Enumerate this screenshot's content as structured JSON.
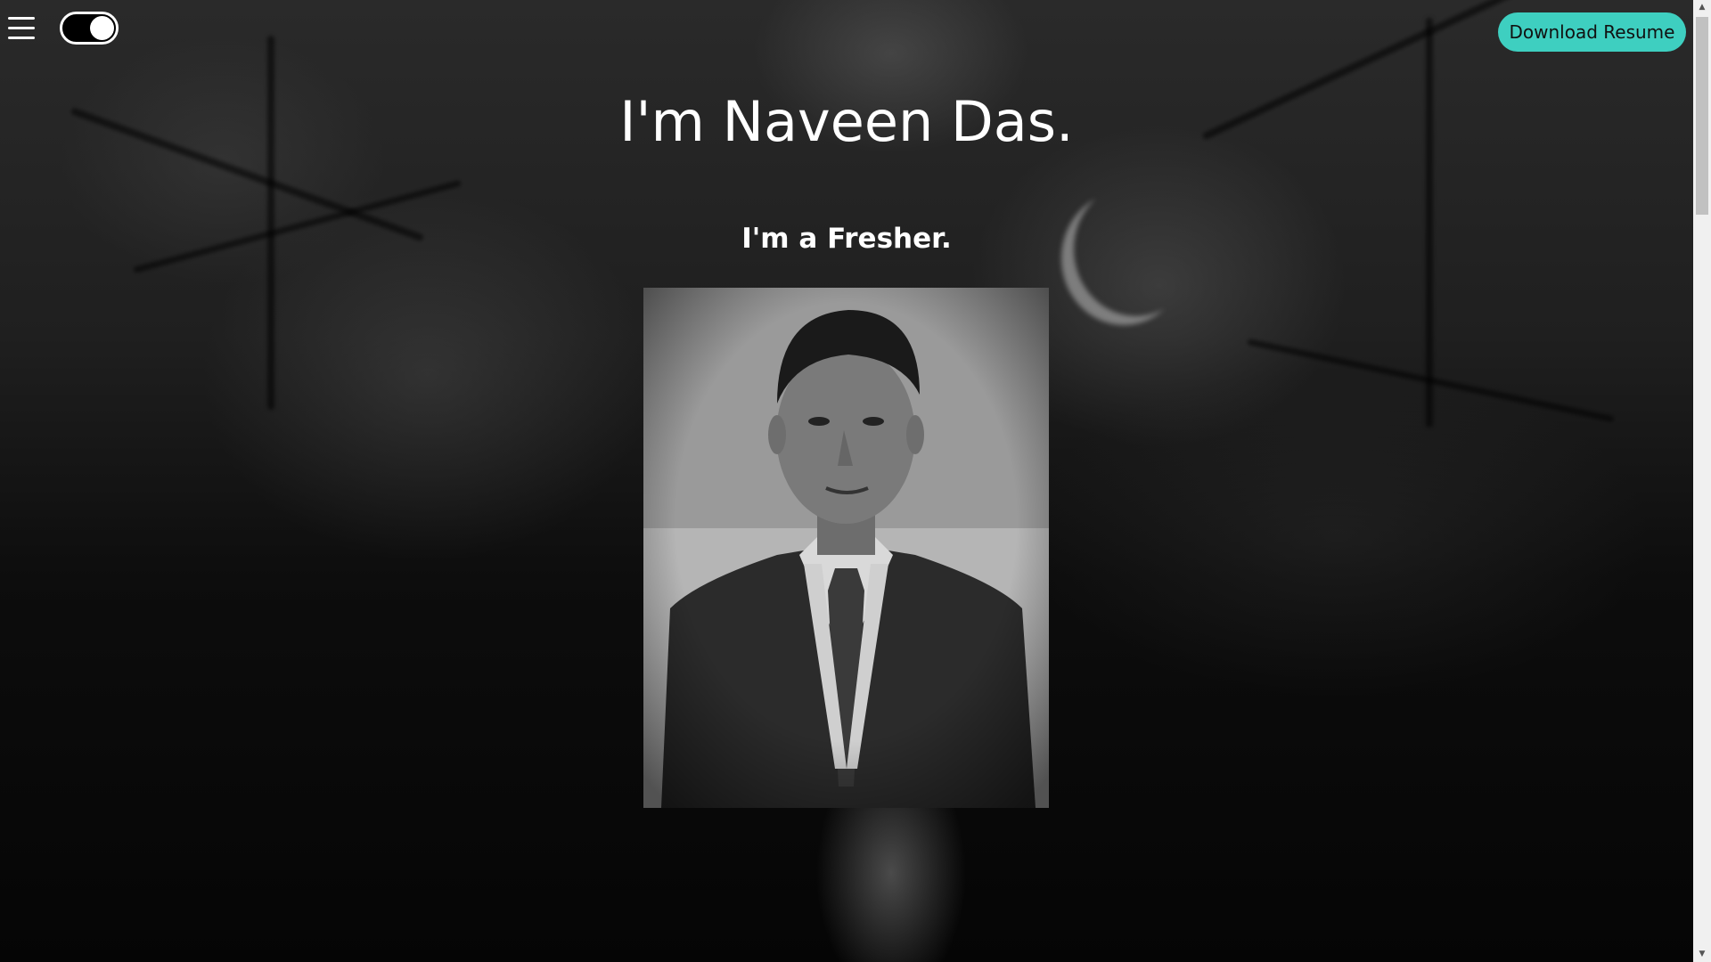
{
  "header": {
    "menu_icon": "hamburger-menu-icon",
    "theme_toggle": {
      "state": "on"
    },
    "download_label": "Download Resume",
    "accent_color": "#3ecfc0"
  },
  "hero": {
    "title": "I'm Naveen Das.",
    "subtitle": "I'm a Fresher."
  },
  "profile_photo": {
    "description": "profile-photo"
  },
  "scrollbar": {
    "up_glyph": "▲",
    "down_glyph": "▼"
  }
}
